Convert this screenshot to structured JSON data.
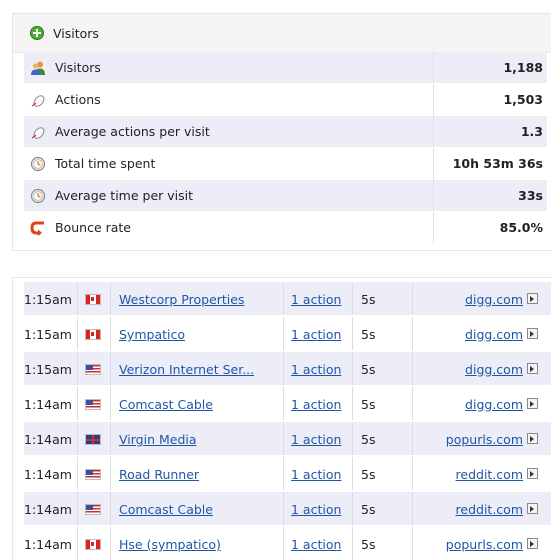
{
  "summary": {
    "title": "Visitors",
    "rows": [
      {
        "label": "Visitors",
        "value": "1,188",
        "icon": "visitors-icon"
      },
      {
        "label": "Actions",
        "value": "1,503",
        "icon": "mouse-icon"
      },
      {
        "label": "Average actions per visit",
        "value": "1.3",
        "icon": "mouse-icon"
      },
      {
        "label": "Total time spent",
        "value": "10h 53m 36s",
        "icon": "clock-icon"
      },
      {
        "label": "Average time per visit",
        "value": "33s",
        "icon": "clock-icon"
      },
      {
        "label": "Bounce rate",
        "value": "85.0%",
        "icon": "bounce-icon"
      }
    ]
  },
  "visits": [
    {
      "time": "1:15am",
      "flag": "canada-flag-icon",
      "isp": "Westcorp Properties",
      "actions": "1 action",
      "duration": "5s",
      "referrer": "digg.com"
    },
    {
      "time": "1:15am",
      "flag": "canada-flag-icon",
      "isp": "Sympatico",
      "actions": "1 action",
      "duration": "5s",
      "referrer": "digg.com"
    },
    {
      "time": "1:15am",
      "flag": "usa-flag-icon",
      "isp": "Verizon Internet Ser...",
      "actions": "1 action",
      "duration": "5s",
      "referrer": "digg.com"
    },
    {
      "time": "1:14am",
      "flag": "usa-flag-icon",
      "isp": "Comcast Cable",
      "actions": "1 action",
      "duration": "5s",
      "referrer": "digg.com"
    },
    {
      "time": "1:14am",
      "flag": "uk-flag-icon",
      "isp": "Virgin Media",
      "actions": "1 action",
      "duration": "5s",
      "referrer": "popurls.com"
    },
    {
      "time": "1:14am",
      "flag": "usa-flag-icon",
      "isp": "Road Runner",
      "actions": "1 action",
      "duration": "5s",
      "referrer": "reddit.com"
    },
    {
      "time": "1:14am",
      "flag": "usa-flag-icon",
      "isp": "Comcast Cable",
      "actions": "1 action",
      "duration": "5s",
      "referrer": "reddit.com"
    },
    {
      "time": "1:14am",
      "flag": "canada-flag-icon",
      "isp": "Hse (sympatico)",
      "actions": "1 action",
      "duration": "5s",
      "referrer": "popurls.com"
    }
  ]
}
